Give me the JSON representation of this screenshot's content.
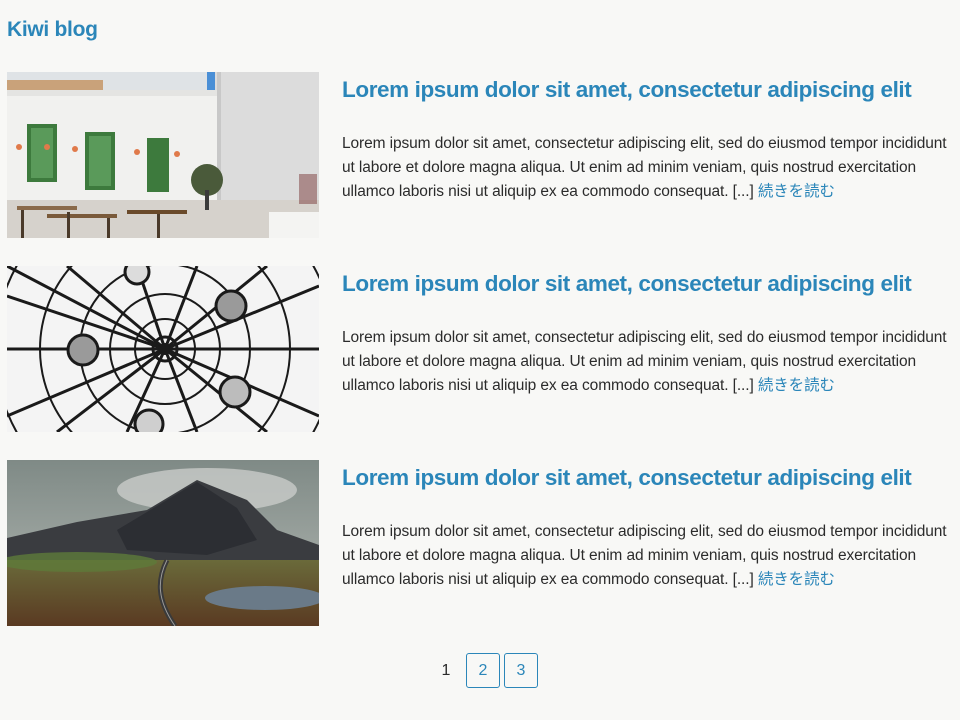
{
  "site": {
    "title": "Kiwi blog"
  },
  "posts": [
    {
      "title": "Lorem ipsum dolor sit amet, consectetur adipiscing elit",
      "excerpt": "Lorem ipsum dolor sit amet, consectetur adipiscing elit, sed do eiusmod tempor incididunt ut labore et dolore magna aliqua. Ut enim ad minim veniam, quis nostrud exercitation ullamco laboris nisi ut aliquip ex ea commodo consequat. [...] ",
      "read_more": "続きを読む"
    },
    {
      "title": "Lorem ipsum dolor sit amet, consectetur adipiscing elit",
      "excerpt": "Lorem ipsum dolor sit amet, consectetur adipiscing elit, sed do eiusmod tempor incididunt ut labore et dolore magna aliqua. Ut enim ad minim veniam, quis nostrud exercitation ullamco laboris nisi ut aliquip ex ea commodo consequat. [...] ",
      "read_more": "続きを読む"
    },
    {
      "title": "Lorem ipsum dolor sit amet, consectetur adipiscing elit",
      "excerpt": "Lorem ipsum dolor sit amet, consectetur adipiscing elit, sed do eiusmod tempor incididunt ut labore et dolore magna aliqua. Ut enim ad minim veniam, quis nostrud exercitation ullamco laboris nisi ut aliquip ex ea commodo consequat. [...] ",
      "read_more": "続きを読む"
    }
  ],
  "pagination": {
    "current": "1",
    "pages": [
      "2",
      "3"
    ]
  },
  "colors": {
    "accent": "#2b86b9",
    "background": "#f8f8f6",
    "text": "#2b2b2b"
  }
}
